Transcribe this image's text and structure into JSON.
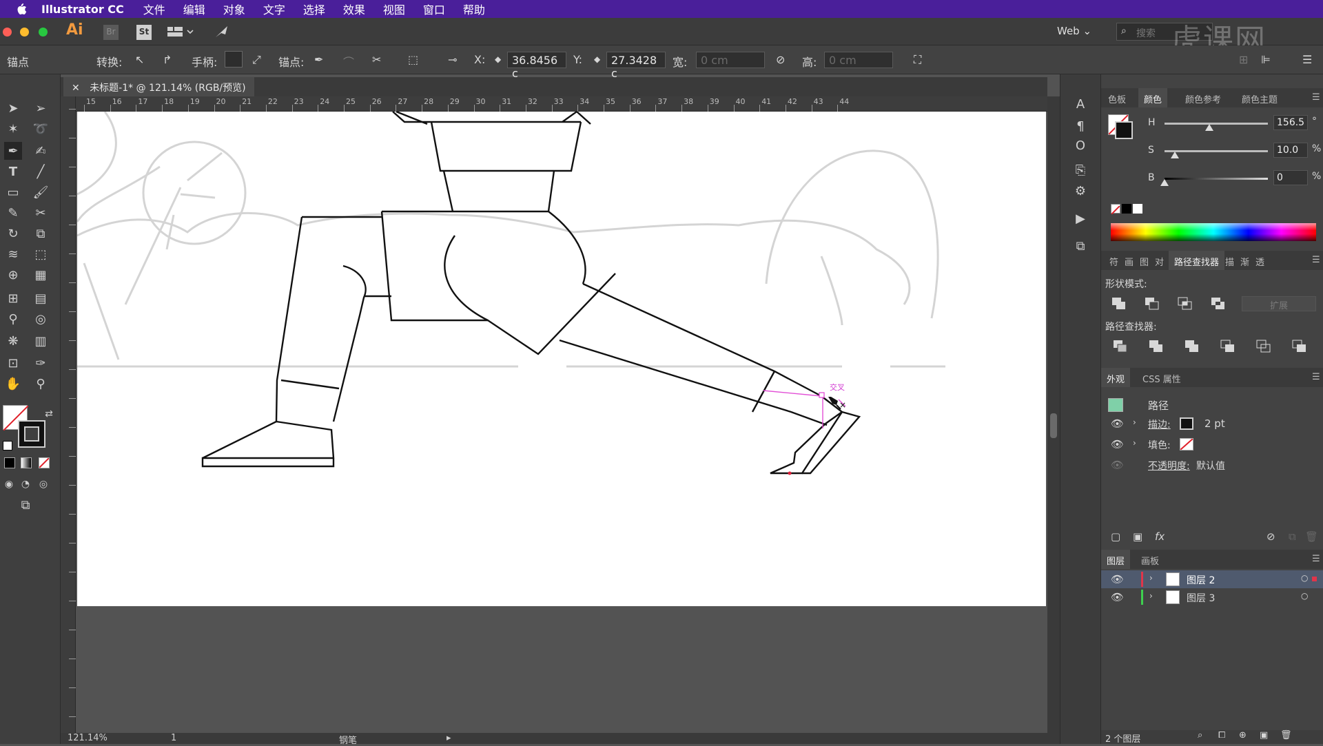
{
  "menubar": {
    "app_name": "Illustrator CC",
    "items": [
      "文件",
      "编辑",
      "对象",
      "文字",
      "选择",
      "效果",
      "视图",
      "窗口",
      "帮助"
    ]
  },
  "appbar": {
    "logo": "Ai",
    "bridge": "Br",
    "stock": "St",
    "workspace": "Web",
    "search_placeholder": "搜索",
    "watermark": "虎课网"
  },
  "control_bar": {
    "mode_label": "锚点",
    "convert_label": "转换:",
    "handles_label": "手柄:",
    "anchors_label": "锚点:",
    "x_label": "X:",
    "x_value": "36.8456 c",
    "y_label": "Y:",
    "y_value": "27.3428 c",
    "width_label": "宽:",
    "width_value": "0 cm",
    "height_label": "高:",
    "height_value": "0 cm"
  },
  "document": {
    "tab_title": "未标题-1* @ 121.14% (RGB/预览)",
    "ruler_ticks": [
      "15",
      "16",
      "17",
      "18",
      "19",
      "20",
      "21",
      "22",
      "23",
      "24",
      "25",
      "26",
      "27",
      "28",
      "29",
      "30",
      "31",
      "32",
      "33",
      "34",
      "35",
      "36",
      "37",
      "38",
      "39",
      "40",
      "41",
      "42",
      "43",
      "44"
    ],
    "smart_guide_label": "交叉"
  },
  "status_bar": {
    "zoom": "121.14%",
    "artboard_number": "1",
    "tool_name": "钢笔"
  },
  "color_panel": {
    "tabs": [
      "色板",
      "颜色",
      "颜色参考",
      "颜色主题"
    ],
    "active_tab": "颜色",
    "h_label": "H",
    "h_value": "156.5",
    "h_unit": "°",
    "s_label": "S",
    "s_value": "10.0",
    "s_unit": "%",
    "b_label": "B",
    "b_value": "0",
    "b_unit": "%",
    "h_level": 0.43,
    "s_level": 0.1,
    "b_level": 0.0
  },
  "pathfinder_panel": {
    "tabs": [
      "符",
      "画",
      "图",
      "对",
      "路径查找器",
      "描",
      "渐",
      "透"
    ],
    "active_tab": "路径查找器",
    "shape_modes_label": "形状模式:",
    "expand_label": "扩展",
    "pathfinders_label": "路径查找器:"
  },
  "appearance_panel": {
    "tabs": [
      "外观",
      "CSS 属性"
    ],
    "active_tab": "外观",
    "object_type": "路径",
    "stroke_label": "描边:",
    "stroke_value": "2 pt",
    "fill_label": "填色:",
    "opacity_label": "不透明度:",
    "opacity_value": "默认值",
    "swatch_color": "#7fd0a8"
  },
  "layers_panel": {
    "tabs": [
      "图层",
      "画板"
    ],
    "active_tab": "图层",
    "layers": [
      {
        "name": "图层 2",
        "color": "#e0354a"
      },
      {
        "name": "图层 3",
        "color": "#3ed04f"
      }
    ],
    "count_label": "2 个图层"
  }
}
